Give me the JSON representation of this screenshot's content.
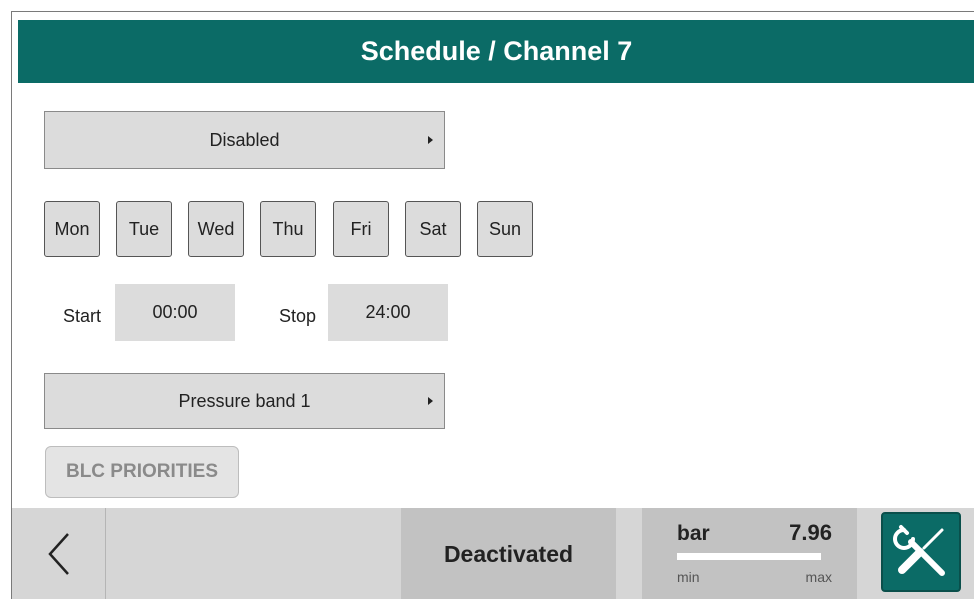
{
  "header": {
    "title": "Schedule / Channel 7"
  },
  "mode_select": {
    "value": "Disabled"
  },
  "days": [
    {
      "label": "Mon"
    },
    {
      "label": "Tue"
    },
    {
      "label": "Wed"
    },
    {
      "label": "Thu"
    },
    {
      "label": "Fri"
    },
    {
      "label": "Sat"
    },
    {
      "label": "Sun"
    }
  ],
  "time": {
    "start_label": "Start",
    "start_value": "00:00",
    "stop_label": "Stop",
    "stop_value": "24:00"
  },
  "band_select": {
    "value": "Pressure band 1"
  },
  "blc_button": {
    "label": "BLC PRIORITIES"
  },
  "bottom_bar": {
    "status": "Deactivated",
    "gauge": {
      "unit": "bar",
      "value": "7.96",
      "min_label": "min",
      "max_label": "max",
      "level": 1.0
    },
    "icons": {
      "back": "chevron-left-icon",
      "tools": "wrench-screwdriver-icon"
    }
  },
  "colors": {
    "accent": "#0b6b66",
    "panel": "#dcdcdc",
    "bar": "#d6d6d6"
  }
}
